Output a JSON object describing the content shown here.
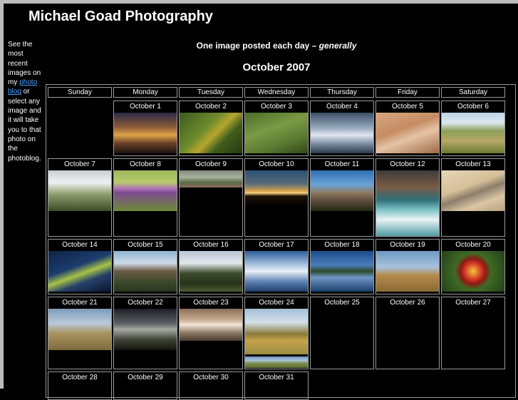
{
  "site": {
    "title": "Michael Goad Photography"
  },
  "sidebar": {
    "text_before": "See the most recent images on my ",
    "link_text": "photo blog",
    "text_after": " or select any image and it will take you to that photo on the photoblog."
  },
  "tagline": {
    "lead": "One image posted each day – ",
    "emphasis": "generally"
  },
  "calendar": {
    "month": "October 2007",
    "weekdays": [
      "Sunday",
      "Monday",
      "Tuesday",
      "Wednesday",
      "Thursday",
      "Friday",
      "Saturday"
    ],
    "days": [
      {
        "label": "October 1",
        "photo": "sunset-clouds"
      },
      {
        "label": "October 2",
        "photo": "yellow-flowers-grass"
      },
      {
        "label": "October 3",
        "photo": "green-grass"
      },
      {
        "label": "October 4",
        "photo": "cloudy-sky"
      },
      {
        "label": "October 5",
        "photo": "driftwood"
      },
      {
        "label": "October 6",
        "photo": "red-truck-field"
      },
      {
        "label": "October 7",
        "photo": "cemetery-headstones"
      },
      {
        "label": "October 8",
        "photo": "purple-thistle"
      },
      {
        "label": "October 9",
        "photo": "road-landscape"
      },
      {
        "label": "October 10",
        "photo": "sunset-horizon"
      },
      {
        "label": "October 11",
        "photo": "rock-formation"
      },
      {
        "label": "October 12",
        "photo": "hot-spring-geyser"
      },
      {
        "label": "October 13",
        "photo": "rock-on-sand"
      },
      {
        "label": "October 14",
        "photo": "backlit-leaf"
      },
      {
        "label": "October 15",
        "photo": "devils-tower"
      },
      {
        "label": "October 16",
        "photo": "pine-trees"
      },
      {
        "label": "October 17",
        "photo": "dramatic-clouds"
      },
      {
        "label": "October 18",
        "photo": "lake-reflection"
      },
      {
        "label": "October 19",
        "photo": "barbed-wire-field"
      },
      {
        "label": "October  20",
        "photo": "red-yellow-flower"
      },
      {
        "label": "October 21",
        "photo": "prairie-landscape"
      },
      {
        "label": "October 22",
        "photo": "storm-clouds-lake"
      },
      {
        "label": "October 23",
        "photo": "town-street"
      },
      {
        "label": "October 24",
        "photo": "hay-bales-field"
      },
      {
        "label": "October 25",
        "photo": ""
      },
      {
        "label": "October 26",
        "photo": ""
      },
      {
        "label": "October 27",
        "photo": ""
      },
      {
        "label": "October 28",
        "photo": ""
      },
      {
        "label": "October 29",
        "photo": ""
      },
      {
        "label": "October 30",
        "photo": ""
      },
      {
        "label": "October 31",
        "photo": ""
      }
    ]
  },
  "colors": {
    "background": "#000000",
    "frame": "#bcbcbc",
    "link": "#4aa3ff",
    "border": "#9a9a9a"
  }
}
